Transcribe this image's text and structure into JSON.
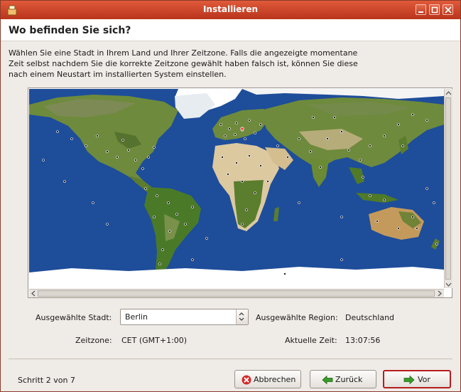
{
  "window": {
    "title": "Installieren"
  },
  "header": {
    "title": "Wo befinden Sie sich?"
  },
  "description": {
    "lines": [
      "Wählen Sie eine Stadt in Ihrem Land und Ihrer Zeitzone. Falls die angezeigte momentane",
      "Zeit selbst nachdem Sie die korrekte Zeitzone gewählt haben falsch ist, können Sie diese",
      "nach einem Neustart im installierten System einstellen."
    ]
  },
  "fields": {
    "city_label": "Ausgewählte Stadt:",
    "city_value": "Berlin",
    "region_label": "Ausgewählte Region:",
    "region_value": "Deutschland",
    "timezone_label": "Zeitzone:",
    "timezone_value": "CET (GMT+1:00)",
    "time_label": "Aktuelle Zeit:",
    "time_value": "13:07:56"
  },
  "footer": {
    "step": "Schritt 2 von 7",
    "cancel": "Abbrechen",
    "back": "Zurück",
    "forward": "Vor"
  },
  "colors": {
    "ocean": "#1e4d9a",
    "land": "#6e8a3c",
    "desert": "#dcc9a0",
    "ice": "#ffffff",
    "title_bar": "#c9452a",
    "default_button_border": "#b41e1e"
  }
}
